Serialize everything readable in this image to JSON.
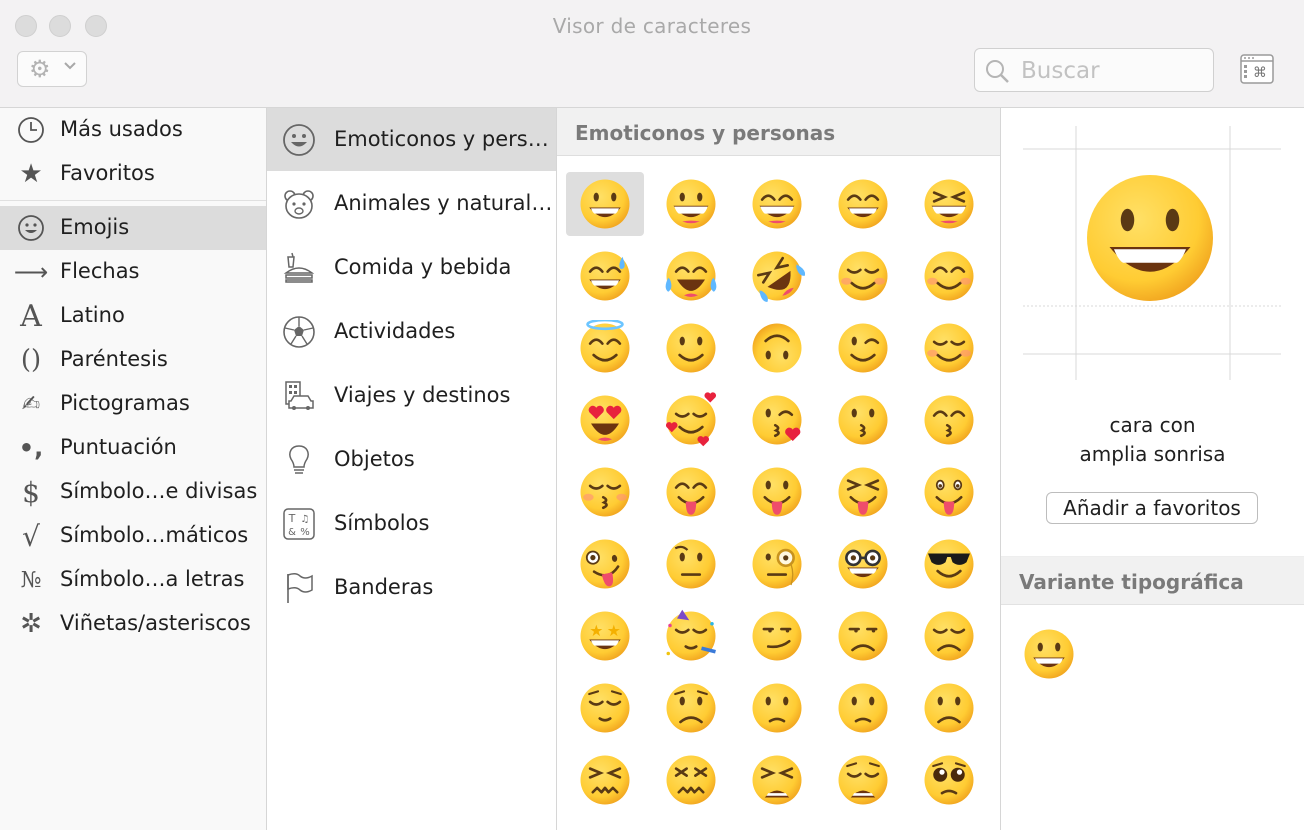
{
  "window": {
    "title": "Visor de caracteres"
  },
  "toolbar": {
    "gear_icon": "gear-icon",
    "search_placeholder": "Buscar",
    "keyboard_icon": "keyboard-viewer-icon"
  },
  "sidebar": {
    "items": [
      {
        "label": "Más usados",
        "icon": "clock-icon"
      },
      {
        "label": "Favoritos",
        "icon": "star-icon"
      },
      {
        "label": "Emojis",
        "icon": "smiley-icon",
        "selected": true
      },
      {
        "label": "Flechas",
        "icon": "arrow-icon"
      },
      {
        "label": "Latino",
        "icon": "latin-a-icon"
      },
      {
        "label": "Paréntesis",
        "icon": "parentheses-icon"
      },
      {
        "label": "Pictogramas",
        "icon": "pictogram-icon"
      },
      {
        "label": "Puntuación",
        "icon": "punctuation-icon"
      },
      {
        "label": "Símbolo…e divisas",
        "icon": "dollar-icon"
      },
      {
        "label": "Símbolo…máticos",
        "icon": "sqrt-icon"
      },
      {
        "label": "Símbolo…a letras",
        "icon": "numero-icon"
      },
      {
        "label": "Viñetas/asteriscos",
        "icon": "asterisk-icon"
      }
    ]
  },
  "categories": {
    "items": [
      {
        "label": "Emoticonos y pers…",
        "icon": "smiley-icon",
        "selected": true
      },
      {
        "label": "Animales y natural…",
        "icon": "bear-icon"
      },
      {
        "label": "Comida y bebida",
        "icon": "burger-drink-icon"
      },
      {
        "label": "Actividades",
        "icon": "soccer-ball-icon"
      },
      {
        "label": "Viajes y destinos",
        "icon": "building-car-icon"
      },
      {
        "label": "Objetos",
        "icon": "lightbulb-icon"
      },
      {
        "label": "Símbolos",
        "icon": "symbols-icon"
      },
      {
        "label": "Banderas",
        "icon": "flag-icon"
      }
    ]
  },
  "grid": {
    "header": "Emoticonos y personas",
    "rows": [
      [
        "grin",
        "smiley",
        "smile",
        "beam",
        "squint"
      ],
      [
        "sweat",
        "joy",
        "rofl",
        "relaxed",
        "blush"
      ],
      [
        "halo",
        "slight",
        "upside",
        "wink",
        "relieved"
      ],
      [
        "heart_eyes",
        "hearts",
        "kiss_heart",
        "kissing",
        "kiss_smile"
      ],
      [
        "kiss_closed",
        "yum",
        "tongue",
        "squint_tongue",
        "wink_tongue"
      ],
      [
        "zany",
        "raised_brow",
        "monocle",
        "nerd",
        "cool"
      ],
      [
        "star_struck",
        "party",
        "smirk",
        "unamused",
        "disappointed"
      ],
      [
        "pensive",
        "worried",
        "confused",
        "slight_frown",
        "frown"
      ],
      [
        "persevere",
        "confounded",
        "tired",
        "weary",
        "pleading"
      ]
    ]
  },
  "detail": {
    "name": "cara con amplia sonrisa",
    "favorite_button": "Añadir a favoritos",
    "variant_header": "Variante tipográfica"
  },
  "colors": {
    "face": "#ffcc33",
    "face_dark": "#f0a21e",
    "feature": "#5a3a14",
    "mouth": "#6b3410",
    "tongue": "#ef4d6b",
    "heart": "#e8223d",
    "blush": "#ff8f7a"
  }
}
